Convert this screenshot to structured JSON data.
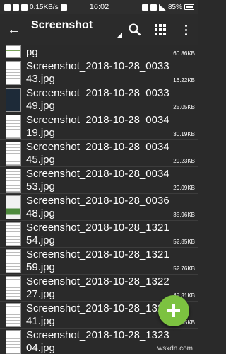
{
  "status_bar": {
    "network_speed": "0.15KB/s",
    "time": "16:02",
    "battery": "85%"
  },
  "toolbar": {
    "title": "Screenshot",
    "icons": [
      "back-arrow",
      "search-icon",
      "grid-view-icon",
      "overflow-menu-icon"
    ]
  },
  "files": [
    {
      "name": "pg",
      "size": "60.86KB",
      "thumb": "mixed"
    },
    {
      "name": "Screenshot_2018-10-28_003343.jpg",
      "size": "16.22KB",
      "thumb": "doc"
    },
    {
      "name": "Screenshot_2018-10-28_003349.jpg",
      "size": "25.05KB",
      "thumb": "dark"
    },
    {
      "name": "Screenshot_2018-10-28_003419.jpg",
      "size": "30.19KB",
      "thumb": "doc"
    },
    {
      "name": "Screenshot_2018-10-28_003445.jpg",
      "size": "29.23KB",
      "thumb": "doc"
    },
    {
      "name": "Screenshot_2018-10-28_003453.jpg",
      "size": "29.09KB",
      "thumb": "doc"
    },
    {
      "name": "Screenshot_2018-10-28_003648.jpg",
      "size": "35.96KB",
      "thumb": "green"
    },
    {
      "name": "Screenshot_2018-10-28_132154.jpg",
      "size": "52.85KB",
      "thumb": "doc"
    },
    {
      "name": "Screenshot_2018-10-28_132159.jpg",
      "size": "52.76KB",
      "thumb": "doc"
    },
    {
      "name": "Screenshot_2018-10-28_132227.jpg",
      "size": "48.31KB",
      "thumb": "doc"
    },
    {
      "name": "Screenshot_2018-10-28_132241.jpg",
      "size": "53.95KB",
      "thumb": "doc"
    },
    {
      "name": "Screenshot_2018-10-28_132304.jpg",
      "size": "",
      "thumb": "doc"
    }
  ],
  "fab": {
    "icon": "plus-icon",
    "color": "#7cc240"
  },
  "watermark": "wsxdn.com"
}
